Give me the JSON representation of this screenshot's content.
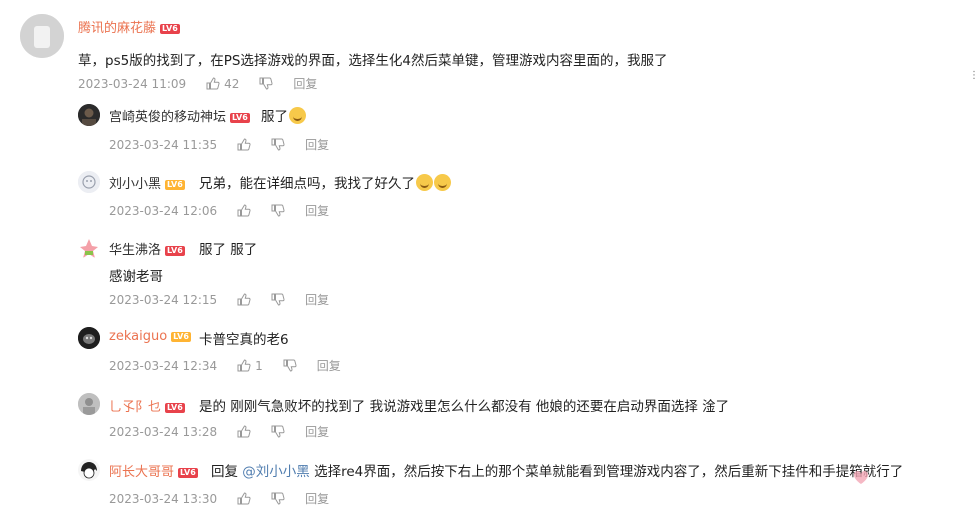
{
  "main_comment": {
    "user": "腾讯的麻花藤",
    "level": "LV6",
    "text": "草，ps5版的找到了，在PS选择游戏的界面，选择生化4然后菜单键，管理游戏内容里面的，我服了",
    "time": "2023-03-24 11:09",
    "likes": "42",
    "reply_label": "回复"
  },
  "replies": [
    {
      "user": "宫崎英俊的移动神坛",
      "level": "LV6",
      "text": "服了",
      "time": "2023-03-24 11:35",
      "likes": "",
      "reply_label": "回复"
    },
    {
      "user": "刘小小黑",
      "level": "LV6",
      "text": "兄弟，能在详细点吗，我找了好久了",
      "time": "2023-03-24 12:06",
      "likes": "",
      "reply_label": "回复"
    },
    {
      "user": "华生沸洛",
      "level": "LV6",
      "text": "服了 服了",
      "text2": "感谢老哥",
      "time": "2023-03-24 12:15",
      "likes": "",
      "reply_label": "回复"
    },
    {
      "user": "zekaiguo",
      "level": "LV6",
      "text": "卡普空真的老6",
      "time": "2023-03-24 12:34",
      "likes": "1",
      "reply_label": "回复"
    },
    {
      "user": "乚孓阝乜",
      "level": "LV6",
      "text": "是的 刚刚气急败坏的找到了 我说游戏里怎么什么都没有 他娘的还要在启动界面选择 淦了",
      "time": "2023-03-24 13:28",
      "likes": "",
      "reply_label": "回复"
    },
    {
      "user": "阿长大哥哥",
      "level": "LV6",
      "text_prefix": "回复",
      "mention": "@刘小小黑",
      "text": "选择re4界面，然后按下右上的那个菜单就能看到管理游戏内容了，然后重新下挂件和手提箱就行了",
      "time": "2023-03-24 13:30",
      "likes": "",
      "reply_label": "回复"
    }
  ],
  "colors": {
    "username": "#eb7350",
    "meta": "#999999",
    "level_badge": "#e8424b",
    "mention": "#507daf"
  },
  "icons": [
    "thumbs-up-icon",
    "thumbs-down-icon",
    "more-icon"
  ]
}
